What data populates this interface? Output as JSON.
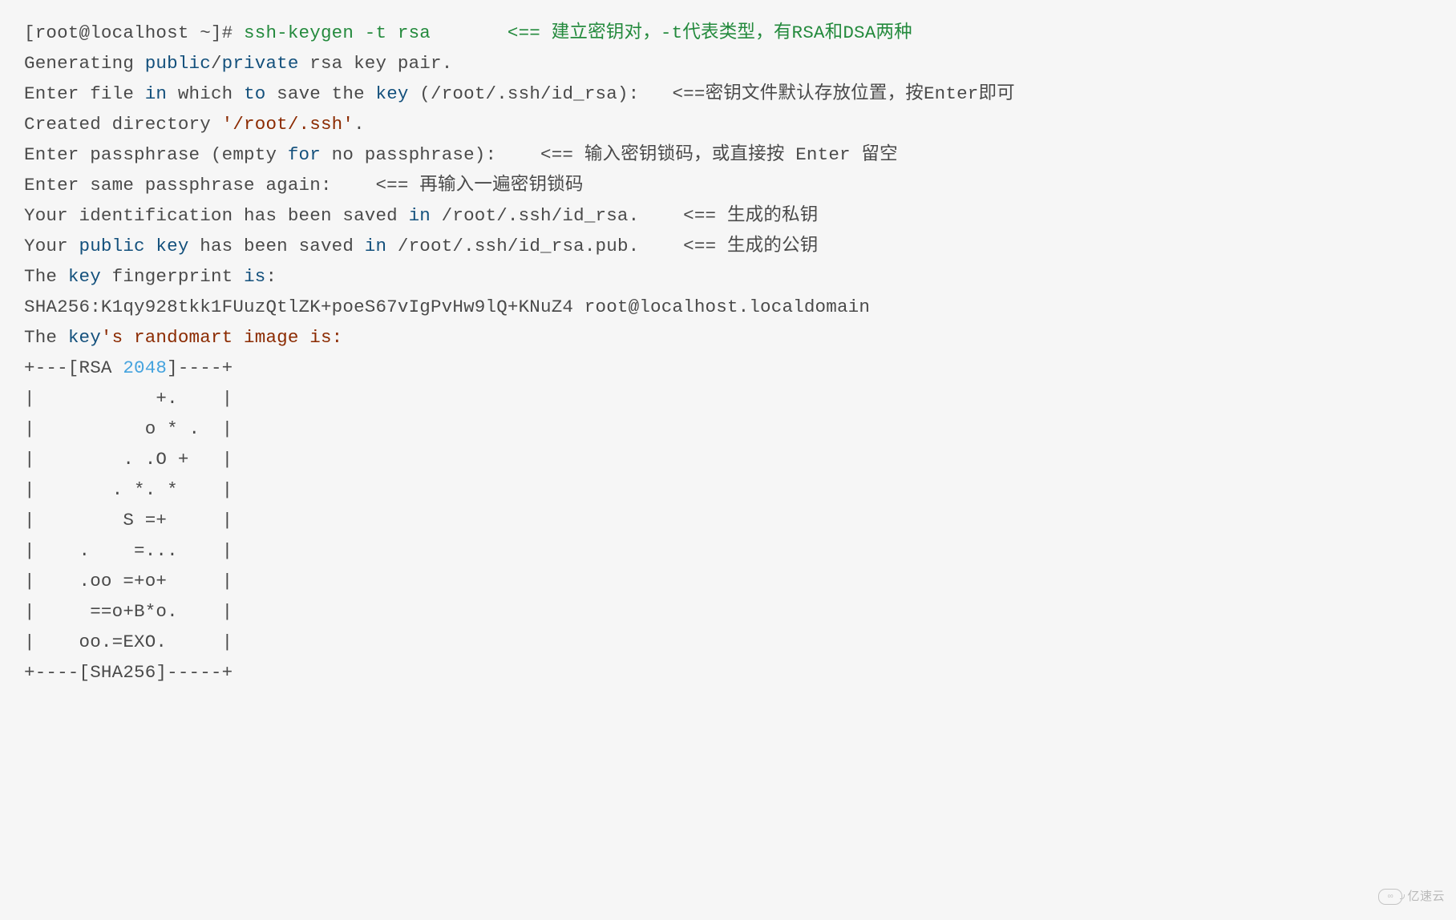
{
  "watermark": "亿速云",
  "lines": [
    [
      {
        "cls": "n",
        "t": "[root@localhost ~]# "
      },
      {
        "cls": "g",
        "t": "ssh-keygen -t rsa       <== 建立密钥对，-t代表类型，有RSA和DSA两种"
      }
    ],
    [
      {
        "cls": "n",
        "t": "Generating "
      },
      {
        "cls": "b",
        "t": "public"
      },
      {
        "cls": "n",
        "t": "/"
      },
      {
        "cls": "b",
        "t": "private"
      },
      {
        "cls": "n",
        "t": " rsa key pair."
      }
    ],
    [
      {
        "cls": "n",
        "t": "Enter file "
      },
      {
        "cls": "b",
        "t": "in"
      },
      {
        "cls": "n",
        "t": " which "
      },
      {
        "cls": "b",
        "t": "to"
      },
      {
        "cls": "n",
        "t": " save the "
      },
      {
        "cls": "b",
        "t": "key"
      },
      {
        "cls": "n",
        "t": " (/root/.ssh/id_rsa):   <==密钥文件默认存放位置，按Enter即可"
      }
    ],
    [
      {
        "cls": "n",
        "t": "Created directory "
      },
      {
        "cls": "r",
        "t": "'/root/.ssh'"
      },
      {
        "cls": "n",
        "t": "."
      }
    ],
    [
      {
        "cls": "n",
        "t": "Enter passphrase (empty "
      },
      {
        "cls": "b",
        "t": "for"
      },
      {
        "cls": "n",
        "t": " no passphrase):    <== 输入密钥锁码，或直接按 Enter 留空"
      }
    ],
    [
      {
        "cls": "n",
        "t": "Enter same passphrase again:    <== 再输入一遍密钥锁码"
      }
    ],
    [
      {
        "cls": "n",
        "t": "Your identification has been saved "
      },
      {
        "cls": "b",
        "t": "in"
      },
      {
        "cls": "n",
        "t": " /root/.ssh/id_rsa.    <== 生成的私钥"
      }
    ],
    [
      {
        "cls": "n",
        "t": "Your "
      },
      {
        "cls": "b",
        "t": "public key"
      },
      {
        "cls": "n",
        "t": " has been saved "
      },
      {
        "cls": "b",
        "t": "in"
      },
      {
        "cls": "n",
        "t": " /root/.ssh/id_rsa.pub.    <== 生成的公钥"
      }
    ],
    [
      {
        "cls": "n",
        "t": "The "
      },
      {
        "cls": "b",
        "t": "key"
      },
      {
        "cls": "n",
        "t": " fingerprint "
      },
      {
        "cls": "b",
        "t": "is"
      },
      {
        "cls": "n",
        "t": ":"
      }
    ],
    [
      {
        "cls": "n",
        "t": "SHA256:K1qy928tkk1FUuzQtlZK+poeS67vIgPvHw9lQ+KNuZ4 root@localhost.localdomain"
      }
    ],
    [
      {
        "cls": "n",
        "t": "The "
      },
      {
        "cls": "b",
        "t": "key"
      },
      {
        "cls": "r",
        "t": "'s randomart image is:"
      }
    ],
    [
      {
        "cls": "n",
        "t": "+---[RSA "
      },
      {
        "cls": "num",
        "t": "2048"
      },
      {
        "cls": "n",
        "t": "]----+"
      }
    ],
    [
      {
        "cls": "n",
        "t": "|           +.    |"
      }
    ],
    [
      {
        "cls": "n",
        "t": "|          o * .  |"
      }
    ],
    [
      {
        "cls": "n",
        "t": "|        . .O +   |"
      }
    ],
    [
      {
        "cls": "n",
        "t": "|       . *. *    |"
      }
    ],
    [
      {
        "cls": "n",
        "t": "|        S =+     |"
      }
    ],
    [
      {
        "cls": "n",
        "t": "|    .    =...    |"
      }
    ],
    [
      {
        "cls": "n",
        "t": "|    .oo =+o+     |"
      }
    ],
    [
      {
        "cls": "n",
        "t": "|     ==o+B*o.    |"
      }
    ],
    [
      {
        "cls": "n",
        "t": "|    oo.=EXO.     |"
      }
    ],
    [
      {
        "cls": "n",
        "t": "+----[SHA256]-----+"
      }
    ]
  ]
}
